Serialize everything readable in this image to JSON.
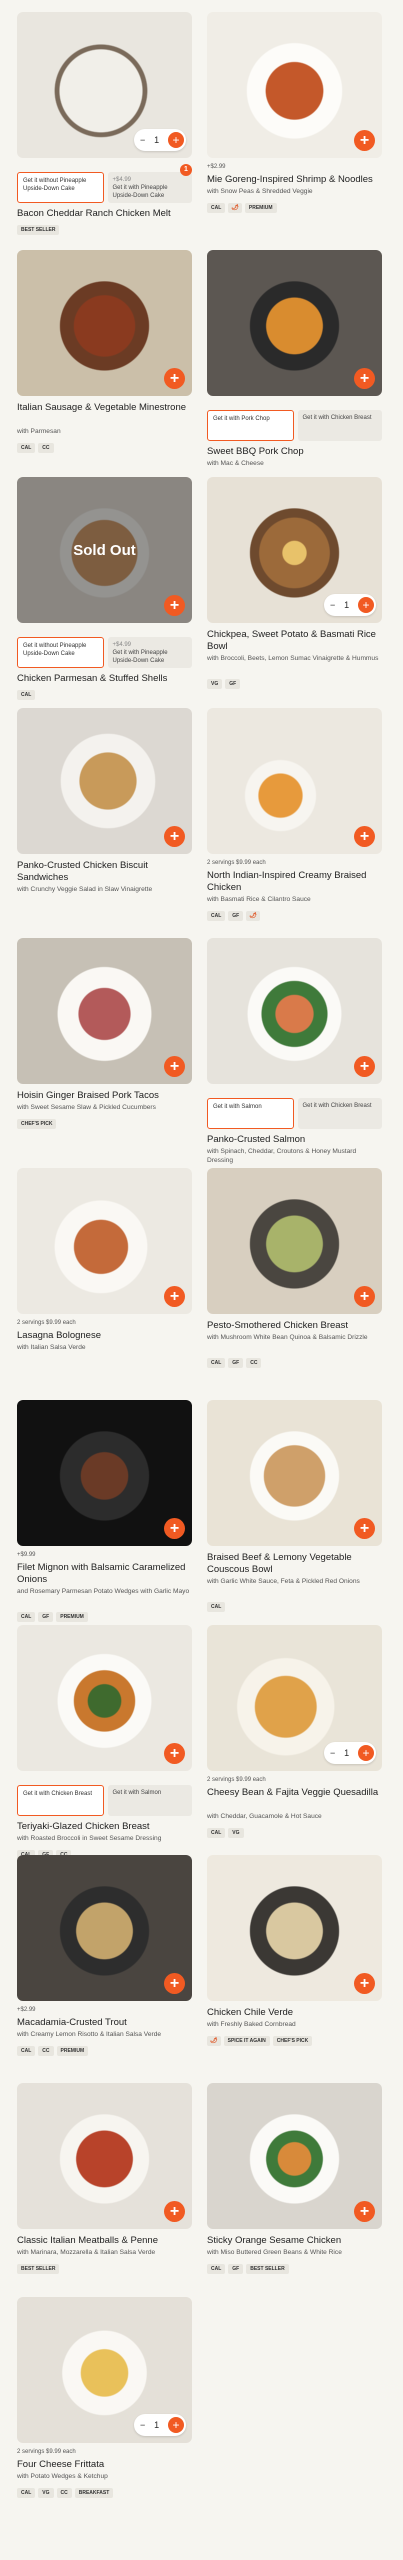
{
  "colors": {
    "accent": "#f15a22",
    "bg": "#f6f5f0",
    "tag": "#e8e6df"
  },
  "cards": [
    {
      "title": "Bacon Cheddar Ranch Chicken Melt",
      "tags": [
        "BEST SELLER"
      ],
      "stepper": "1",
      "options": [
        {
          "label": "Get it without Pineapple Upside-Down Cake",
          "selected": true
        },
        {
          "label": "Get it with Pineapple Upside-Down Cake",
          "price": "+$4.99",
          "selected": false
        }
      ],
      "badge": "1"
    },
    {
      "price": "+$2.99",
      "title": "Mie Goreng-Inspired Shrimp & Noodles",
      "subtitle": "with Snow Peas & Shredded Veggie",
      "tags": [
        "CAL",
        "🌶",
        "PREMIUM"
      ]
    },
    {
      "title": "Italian Sausage & Vegetable Minestrone",
      "subtitle": "with Parmesan",
      "tags": [
        "CAL",
        "CC"
      ]
    },
    {
      "title": "Sweet BBQ Pork Chop",
      "subtitle": "with Mac & Cheese",
      "options": [
        {
          "label": "Get it with Pork Chop",
          "selected": true
        },
        {
          "label": "Get it with Chicken Breast",
          "selected": false
        }
      ]
    },
    {
      "title": "Chicken Parmesan & Stuffed Shells",
      "tags": [
        "CAL"
      ],
      "sold_out": "Sold Out",
      "options": [
        {
          "label": "Get it without Pineapple Upside-Down Cake",
          "selected": true
        },
        {
          "label": "Get it with Pineapple Upside-Down Cake",
          "price": "+$4.99",
          "selected": false
        }
      ]
    },
    {
      "title": "Chickpea, Sweet Potato & Basmati Rice Bowl",
      "subtitle": "with Broccoli, Beets, Lemon Sumac Vinaigrette & Hummus",
      "tags": [
        "VG",
        "GF"
      ],
      "stepper": "1"
    },
    {
      "title": "Panko-Crusted Chicken Biscuit Sandwiches",
      "subtitle": "with Crunchy Veggie Salad in Slaw Vinaigrette"
    },
    {
      "price": "2 servings $9.99 each",
      "title": "North Indian-Inspired Creamy Braised Chicken",
      "subtitle": "with Basmati Rice & Cilantro Sauce",
      "tags": [
        "CAL",
        "GF",
        "🌶"
      ]
    },
    {
      "title": "Hoisin Ginger Braised Pork Tacos",
      "subtitle": "with Sweet Sesame Slaw & Pickled Cucumbers",
      "tags": [
        "CHEF'S PICK"
      ]
    },
    {
      "title": "Panko-Crusted Salmon",
      "subtitle": "with Spinach, Cheddar, Croutons & Honey Mustard Dressing",
      "tags": [
        "CAL",
        "CC"
      ],
      "options": [
        {
          "label": "Get it with Salmon",
          "selected": true
        },
        {
          "label": "Get it with Chicken Breast",
          "selected": false
        }
      ]
    },
    {
      "price": "2 servings $9.99 each",
      "title": "Lasagna Bolognese",
      "subtitle": "with Italian Salsa Verde"
    },
    {
      "title": "Pesto-Smothered Chicken Breast",
      "subtitle": "with Mushroom White Bean Quinoa & Balsamic Drizzle",
      "tags": [
        "CAL",
        "GF",
        "CC"
      ]
    },
    {
      "price": "+$9.99",
      "title": "Filet Mignon with Balsamic Caramelized Onions",
      "subtitle": "and Rosemary Parmesan Potato Wedges with Garlic Mayo",
      "tags": [
        "CAL",
        "GF",
        "PREMIUM"
      ]
    },
    {
      "title": "Braised Beef & Lemony Vegetable Couscous Bowl",
      "subtitle": "with Garlic White Sauce, Feta & Pickled Red Onions",
      "tags": [
        "CAL"
      ]
    },
    {
      "title": "Teriyaki-Glazed Chicken Breast",
      "subtitle": "with Roasted Broccoli in Sweet Sesame Dressing",
      "tags": [
        "CAL",
        "GF",
        "CC"
      ],
      "options": [
        {
          "label": "Get it with Chicken Breast",
          "selected": true
        },
        {
          "label": "Get it with Salmon",
          "selected": false
        }
      ]
    },
    {
      "price": "2 servings $9.99 each",
      "title": "Cheesy Bean & Fajita Veggie Quesadilla",
      "subtitle": "with Cheddar, Guacamole & Hot Sauce",
      "tags": [
        "CAL",
        "VG"
      ],
      "stepper": "1"
    },
    {
      "price": "+$2.99",
      "title": "Macadamia-Crusted Trout",
      "subtitle": "with Creamy Lemon Risotto & Italian Salsa Verde",
      "tags": [
        "CAL",
        "CC",
        "PREMIUM"
      ]
    },
    {
      "title": "Chicken Chile Verde",
      "subtitle": "with Freshly Baked Cornbread",
      "tags": [
        "🌶",
        "SPICE IT AGAIN",
        "CHEF'S PICK"
      ]
    },
    {
      "title": "Classic Italian Meatballs & Penne",
      "subtitle": "with Marinara, Mozzarella & Italian Salsa Verde",
      "tags": [
        "BEST SELLER"
      ]
    },
    {
      "title": "Sticky Orange Sesame Chicken",
      "subtitle": "with Miso Buttered Green Beans & White Rice",
      "tags": [
        "CAL",
        "GF",
        "BEST SELLER"
      ]
    },
    {
      "price": "2 servings $9.99 each",
      "title": "Four Cheese Frittata",
      "subtitle": "with Potato Wedges & Ketchup",
      "tags": [
        "CAL",
        "VG",
        "CC",
        "BREAKFAST"
      ],
      "stepper": "1"
    }
  ]
}
